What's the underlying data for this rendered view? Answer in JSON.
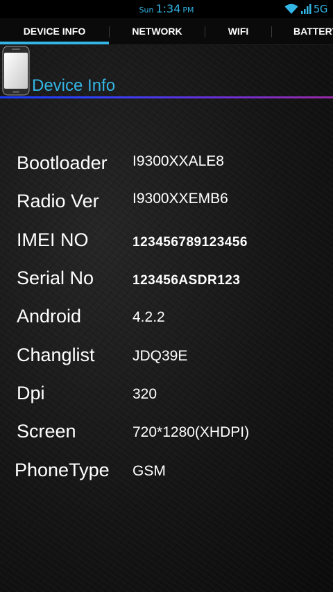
{
  "status_bar": {
    "day": "Sun",
    "time": "1:34",
    "ampm": "PM",
    "network_type": "5G",
    "wifi_icon": "wifi-icon",
    "signal_icon": "signal-bars-icon"
  },
  "tabs": [
    {
      "label": "DEVICE INFO",
      "active": true
    },
    {
      "label": "NETWORK",
      "active": false
    },
    {
      "label": "WIFI",
      "active": false
    },
    {
      "label": "BATTERY",
      "active": false
    }
  ],
  "header": {
    "icon": "phone-icon",
    "title": "Device Info"
  },
  "device_info": [
    {
      "label": "Bootloader",
      "value": "I9300XXALE8"
    },
    {
      "label": "Radio Ver",
      "value": "I9300XXEMB6"
    },
    {
      "label": "IMEI NO",
      "value": "123456789123456"
    },
    {
      "label": "Serial No",
      "value": "123456ASDR123"
    },
    {
      "label": "Android",
      "value": "4.2.2"
    },
    {
      "label": "Changlist",
      "value": "JDQ39E"
    },
    {
      "label": "Dpi",
      "value": "320"
    },
    {
      "label": "Screen",
      "value": "720*1280(XHDPI)"
    },
    {
      "label": "PhoneType",
      "value": "GSM"
    }
  ],
  "colors": {
    "accent": "#33b5e5",
    "background": "#151515",
    "text": "#ffffff"
  }
}
